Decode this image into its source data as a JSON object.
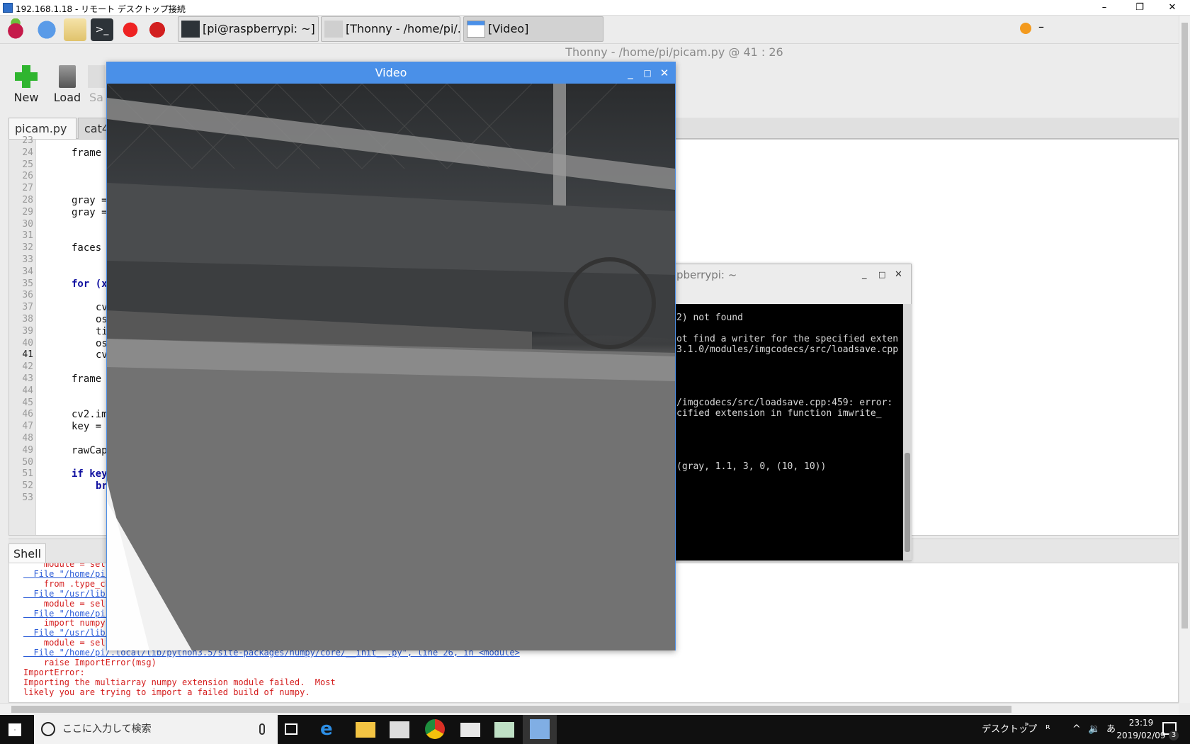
{
  "rdp": {
    "title": "192.168.1.18 - リモート デスクトップ接続",
    "minimize": "–",
    "restore": "❐",
    "close": "✕"
  },
  "pi_taskbar": {
    "tasks": [
      {
        "label": "[pi@raspberrypi: ~]"
      },
      {
        "label": "[Thonny  -  /home/pi/..."
      },
      {
        "label": "[Video]"
      }
    ],
    "tray_dash": "–"
  },
  "thonny": {
    "title": "Thonny  -  /home/pi/picam.py  @  41 : 26",
    "toolbar": {
      "new": "New",
      "load": "Load",
      "save": "Sa"
    },
    "tabs": [
      {
        "label": "picam.py ✖"
      },
      {
        "label": "cat4."
      }
    ],
    "line_numbers": [
      "23",
      "24",
      "25",
      "26",
      "27",
      "28",
      "29",
      "30",
      "31",
      "32",
      "33",
      "34",
      "35",
      "36",
      "37",
      "38",
      "39",
      "40",
      "41",
      "42",
      "43",
      "44",
      "45",
      "46",
      "47",
      "48",
      "49",
      "50",
      "51",
      "52",
      "53"
    ],
    "code_lines": [
      {
        "text": "frame",
        "indent": 0,
        "row": 1
      },
      {
        "text": "gray =",
        "indent": 0,
        "row": 5
      },
      {
        "text": "gray =",
        "indent": 0,
        "row": 6
      },
      {
        "text": "faces",
        "indent": 0,
        "row": 9
      },
      {
        "text": "for (x",
        "indent": 0,
        "row": 12,
        "kw": true
      },
      {
        "text": "cv",
        "indent": 1,
        "row": 14
      },
      {
        "text": "os",
        "indent": 1,
        "row": 15
      },
      {
        "text": "ti",
        "indent": 1,
        "row": 16
      },
      {
        "text": "os",
        "indent": 1,
        "row": 17
      },
      {
        "text": "cv",
        "indent": 1,
        "row": 18
      },
      {
        "text": "frame",
        "indent": 0,
        "row": 20
      },
      {
        "text": "cv2.im",
        "indent": 0,
        "row": 23
      },
      {
        "text": "key =",
        "indent": 0,
        "row": 24
      },
      {
        "text": "rawCap",
        "indent": 0,
        "row": 26
      },
      {
        "text": "if key",
        "indent": 0,
        "row": 28,
        "kw": true
      },
      {
        "text": "br",
        "indent": 1,
        "row": 29,
        "kw": true
      }
    ],
    "shell_tab": "Shell",
    "shell_lines": [
      {
        "text": "    module = self",
        "link": false
      },
      {
        "text": "  File \"/home/pi/",
        "link": true
      },
      {
        "text": "    from .type_ch",
        "link": false
      },
      {
        "text": "  File \"/usr/lib/",
        "link": true
      },
      {
        "text": "    module = self",
        "link": false
      },
      {
        "text": "  File \"/home/pi/",
        "link": true
      },
      {
        "text": "    import numpy.",
        "link": false
      },
      {
        "text": "  File \"/usr/lib/",
        "link": true
      },
      {
        "text": "    module = self",
        "link": false
      },
      {
        "text": "  File \"/home/pi/.local/lib/python3.5/site-packages/numpy/core/__init__.py\", line 26, in <module>",
        "link": true
      },
      {
        "text": "    raise ImportError(msg)",
        "link": false
      },
      {
        "text": "ImportError:",
        "link": false
      },
      {
        "text": "Importing the multiarray numpy extension module failed.  Most",
        "link": false
      },
      {
        "text": "likely you are trying to import a failed build of numpy.",
        "link": false
      }
    ]
  },
  "terminal": {
    "title": "pberrypi: ~",
    "lines": [
      {
        "text": "2) not found",
        "row": 0
      },
      {
        "text": "ot find a writer for the specified exten",
        "row": 2
      },
      {
        "text": "3.1.0/modules/imgcodecs/src/loadsave.cpp",
        "row": 3
      },
      {
        "text": "/imgcodecs/src/loadsave.cpp:459: error:",
        "row": 8
      },
      {
        "text": "cified extension in function imwrite_",
        "row": 9
      },
      {
        "text": "(gray, 1.1, 3, 0, (10, 10))",
        "row": 14
      }
    ]
  },
  "video": {
    "title": "Video",
    "minimize": "_",
    "maximize": "□",
    "close": "✕"
  },
  "windows_taskbar": {
    "search_placeholder": "ここに入力して検索",
    "desktop_label": "デスクトップ",
    "time": "23:19",
    "date": "2019/02/09",
    "notifications": "3"
  },
  "colors": {
    "video_title_bg": "#4a90e8",
    "shell_error": "#d41c1c",
    "shell_link": "#2a5bd7"
  }
}
